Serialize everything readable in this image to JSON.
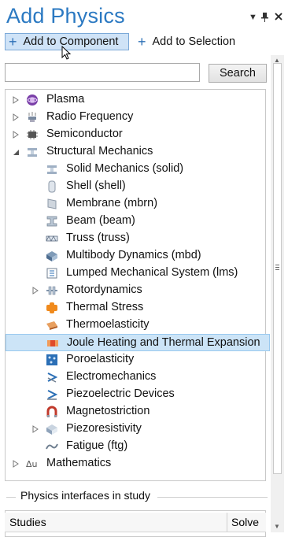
{
  "window": {
    "title": "Add Physics",
    "controls": {
      "dropdown": "▾",
      "pin": "📌",
      "close": "✕"
    }
  },
  "toolbar": {
    "add_component_label": "Add to Component",
    "add_selection_label": "Add to Selection"
  },
  "search": {
    "placeholder": "",
    "value": "",
    "button_label": "Search"
  },
  "tree": {
    "items": [
      {
        "label": "Plasma",
        "icon": "plasma-icon",
        "level": 0,
        "expander": "collapsed"
      },
      {
        "label": "Radio Frequency",
        "icon": "radio-frequency-icon",
        "level": 0,
        "expander": "collapsed"
      },
      {
        "label": "Semiconductor",
        "icon": "semiconductor-icon",
        "level": 0,
        "expander": "collapsed"
      },
      {
        "label": "Structural Mechanics",
        "icon": "structural-mechanics-icon",
        "level": 0,
        "expander": "expanded"
      },
      {
        "label": "Solid Mechanics (solid)",
        "icon": "solid-mechanics-icon",
        "level": 1,
        "expander": "none"
      },
      {
        "label": "Shell (shell)",
        "icon": "shell-icon",
        "level": 1,
        "expander": "none"
      },
      {
        "label": "Membrane (mbrn)",
        "icon": "membrane-icon",
        "level": 1,
        "expander": "none"
      },
      {
        "label": "Beam (beam)",
        "icon": "beam-icon",
        "level": 1,
        "expander": "none"
      },
      {
        "label": "Truss (truss)",
        "icon": "truss-icon",
        "level": 1,
        "expander": "none"
      },
      {
        "label": "Multibody Dynamics (mbd)",
        "icon": "multibody-icon",
        "level": 1,
        "expander": "none"
      },
      {
        "label": "Lumped Mechanical System (lms)",
        "icon": "lumped-system-icon",
        "level": 1,
        "expander": "none"
      },
      {
        "label": "Rotordynamics",
        "icon": "rotordynamics-icon",
        "level": 1,
        "expander": "collapsed"
      },
      {
        "label": "Thermal Stress",
        "icon": "thermal-stress-icon",
        "level": 1,
        "expander": "none"
      },
      {
        "label": "Thermoelasticity",
        "icon": "thermoelasticity-icon",
        "level": 1,
        "expander": "none"
      },
      {
        "label": "Joule Heating and Thermal Expansion",
        "icon": "joule-heating-icon",
        "level": 1,
        "expander": "none",
        "selected": true
      },
      {
        "label": "Poroelasticity",
        "icon": "poroelasticity-icon",
        "level": 1,
        "expander": "none"
      },
      {
        "label": "Electromechanics",
        "icon": "electromechanics-icon",
        "level": 1,
        "expander": "none"
      },
      {
        "label": "Piezoelectric Devices",
        "icon": "piezoelectric-icon",
        "level": 1,
        "expander": "none"
      },
      {
        "label": "Magnetostriction",
        "icon": "magnetostriction-icon",
        "level": 1,
        "expander": "none"
      },
      {
        "label": "Piezoresistivity",
        "icon": "piezoresistivity-icon",
        "level": 1,
        "expander": "collapsed"
      },
      {
        "label": "Fatigue (ftg)",
        "icon": "fatigue-icon",
        "level": 1,
        "expander": "none"
      },
      {
        "label": "Mathematics",
        "icon": "mathematics-icon",
        "level": 0,
        "expander": "collapsed"
      }
    ]
  },
  "section": {
    "title": "Physics interfaces in study"
  },
  "studies_table": {
    "columns": [
      "Studies",
      "Solve"
    ]
  },
  "colors": {
    "title": "#2b79c2",
    "selection": "#cce4f7",
    "active_button": "#cfe3f7"
  }
}
